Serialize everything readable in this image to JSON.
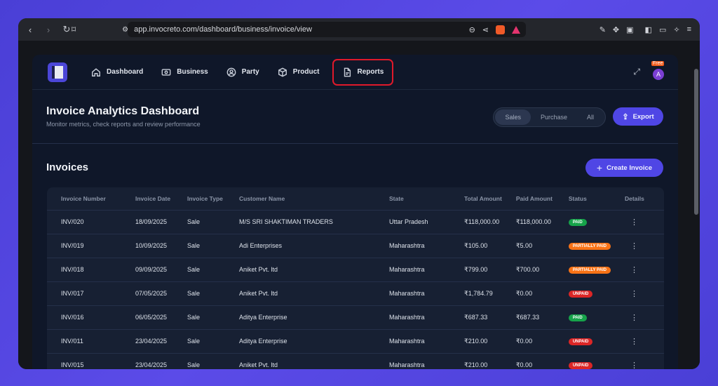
{
  "browser": {
    "url": "app.invocreto.com/dashboard/business/invoice/view"
  },
  "nav": {
    "items": [
      {
        "label": "Dashboard",
        "icon": "home-icon"
      },
      {
        "label": "Business",
        "icon": "business-icon"
      },
      {
        "label": "Party",
        "icon": "user-circle-icon"
      },
      {
        "label": "Product",
        "icon": "box-icon"
      },
      {
        "label": "Reports",
        "icon": "file-icon"
      }
    ],
    "free_badge": "Free",
    "avatar_initial": "A"
  },
  "header": {
    "title": "Invoice Analytics Dashboard",
    "subtitle": "Monitor metrics, check reports and review performance",
    "toggle": [
      "Sales",
      "Purchase",
      "All"
    ],
    "export_label": "Export"
  },
  "invoices": {
    "title": "Invoices",
    "create_label": "Create Invoice",
    "columns": [
      "Invoice Number",
      "Invoice Date",
      "Invoice Type",
      "Customer Name",
      "State",
      "Total Amount",
      "Paid Amount",
      "Status",
      "Details"
    ],
    "rows": [
      {
        "number": "INV/020",
        "date": "18/09/2025",
        "type": "Sale",
        "customer": "M/S SRI SHAKTIMAN TRADERS",
        "state": "Uttar Pradesh",
        "total": "₹118,000.00",
        "paid": "₹118,000.00",
        "status": "PAID"
      },
      {
        "number": "INV/019",
        "date": "10/09/2025",
        "type": "Sale",
        "customer": "Adi Enterprises",
        "state": "Maharashtra",
        "total": "₹105.00",
        "paid": "₹5.00",
        "status": "PARTIALLY PAID"
      },
      {
        "number": "INV/018",
        "date": "09/09/2025",
        "type": "Sale",
        "customer": "Aniket Pvt. ltd",
        "state": "Maharashtra",
        "total": "₹799.00",
        "paid": "₹700.00",
        "status": "PARTIALLY PAID"
      },
      {
        "number": "INV/017",
        "date": "07/05/2025",
        "type": "Sale",
        "customer": "Aniket Pvt. ltd",
        "state": "Maharashtra",
        "total": "₹1,784.79",
        "paid": "₹0.00",
        "status": "UNPAID"
      },
      {
        "number": "INV/016",
        "date": "06/05/2025",
        "type": "Sale",
        "customer": "Aditya Enterprise",
        "state": "Maharashtra",
        "total": "₹687.33",
        "paid": "₹687.33",
        "status": "PAID"
      },
      {
        "number": "INV/011",
        "date": "23/04/2025",
        "type": "Sale",
        "customer": "Aditya Enterprise",
        "state": "Maharashtra",
        "total": "₹210.00",
        "paid": "₹0.00",
        "status": "UNPAID"
      },
      {
        "number": "INV/015",
        "date": "23/04/2025",
        "type": "Sale",
        "customer": "Aniket Pvt. ltd",
        "state": "Maharashtra",
        "total": "₹210.00",
        "paid": "₹0.00",
        "status": "UNPAID"
      }
    ]
  },
  "colors": {
    "accent": "#4f46e5",
    "paid": "#16a34a",
    "partially_paid": "#f97316",
    "unpaid": "#dc2626",
    "highlight": "#e0192a"
  }
}
